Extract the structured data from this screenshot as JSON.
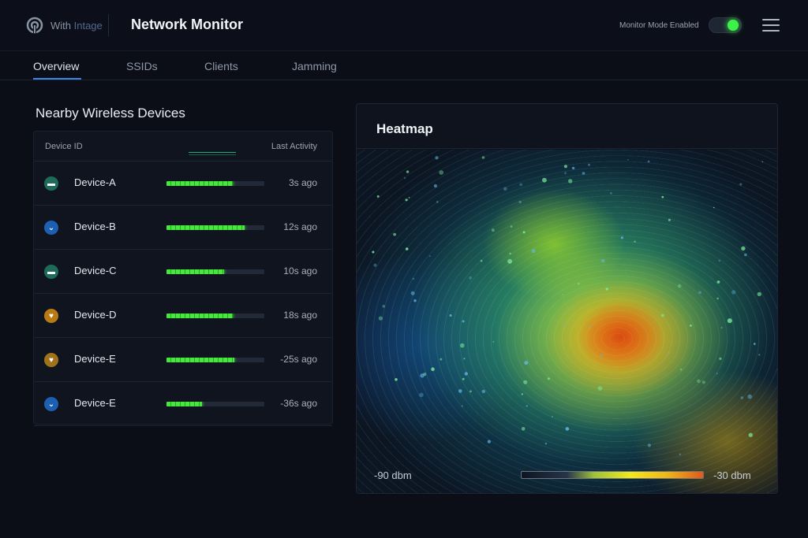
{
  "brand": {
    "prefix": "With",
    "name": "Intage",
    "logo_icon": "brand-logo-icon"
  },
  "app_title": "Network Monitor",
  "monitor_mode": {
    "label": "Monitor Mode Enabled",
    "enabled": true,
    "accent": "#3ef04a"
  },
  "menu_icon": "hamburger-menu-icon",
  "tabs": [
    {
      "label": "Overview",
      "active": true
    },
    {
      "label": "SSIDs",
      "active": false
    },
    {
      "label": "Clients",
      "active": false
    },
    {
      "label": "Jamming",
      "active": false
    }
  ],
  "devices": {
    "title": "Nearby Wireless Devices",
    "col_id": "Device ID",
    "col_activity": "Last Activity",
    "rows": [
      {
        "name": "Device-A",
        "activity": 0.68,
        "time": "3s ago",
        "icon": "router-icon",
        "icon_color": "#1e6b5c"
      },
      {
        "name": "Device-B",
        "activity": 0.8,
        "time": "12s ago",
        "icon": "chevron-down-icon",
        "icon_color": "#1d5fb0"
      },
      {
        "name": "Device-C",
        "activity": 0.59,
        "time": "10s ago",
        "icon": "router-icon",
        "icon_color": "#1e6b5c"
      },
      {
        "name": "Device-D",
        "activity": 0.68,
        "time": "18s ago",
        "icon": "bird-icon",
        "icon_color": "#b97a14"
      },
      {
        "name": "Device-E",
        "activity": 0.69,
        "time": "-25s ago",
        "icon": "bird-icon",
        "icon_color": "#a0721a"
      },
      {
        "name": "Device-E",
        "activity": 0.36,
        "time": "-36s ago",
        "icon": "chevron-down-icon",
        "icon_color": "#1d5fb0"
      }
    ]
  },
  "heatmap": {
    "title": "Heatmap",
    "scale_min": "-90 dbm",
    "scale_max": "-30 dbm"
  }
}
